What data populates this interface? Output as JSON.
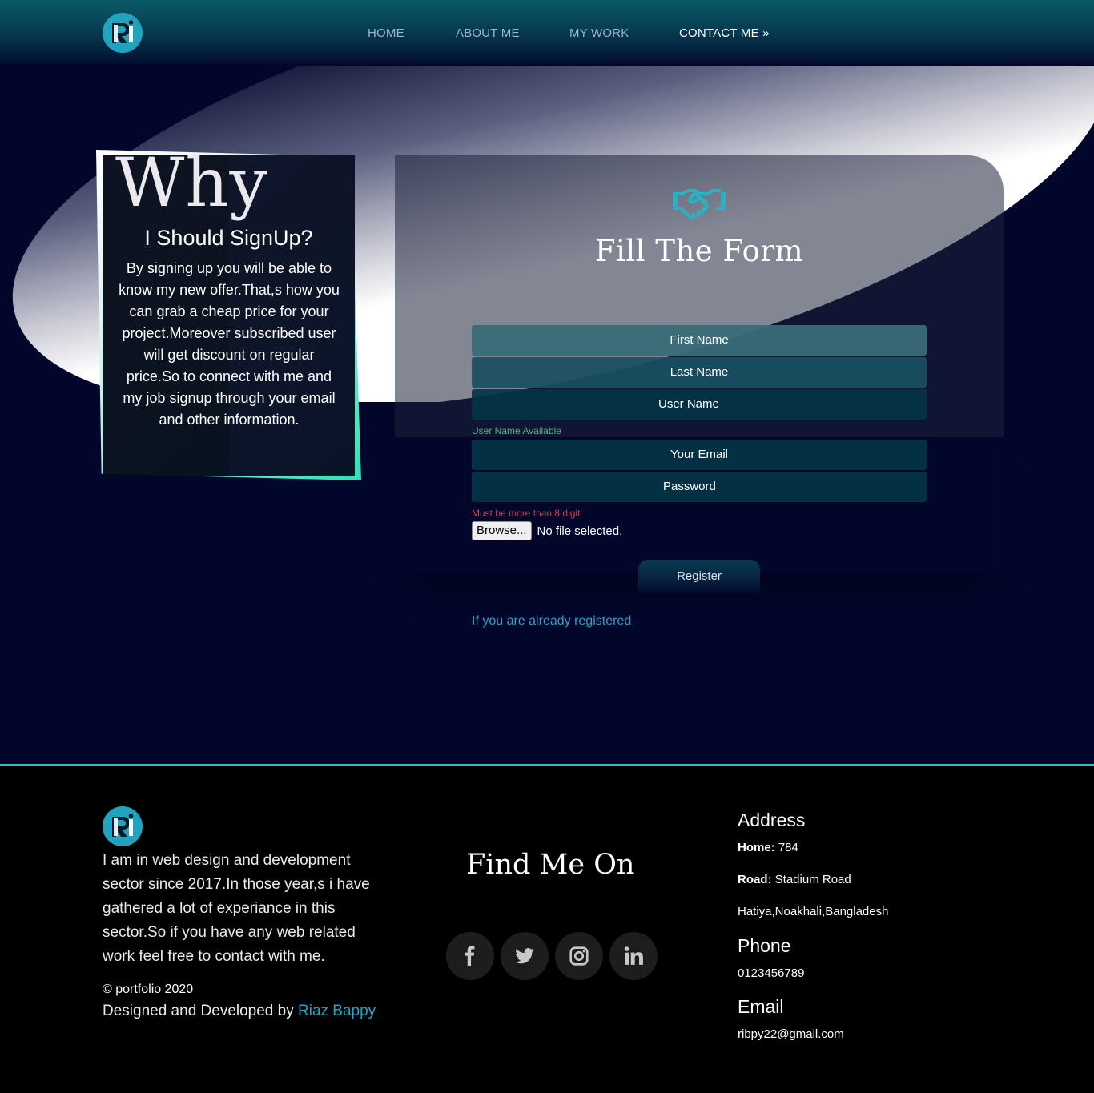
{
  "nav": {
    "logo_alt": "logo",
    "links": [
      {
        "label": "HOME",
        "active": false
      },
      {
        "label": "ABOUT ME",
        "active": false
      },
      {
        "label": "MY WORK",
        "active": false
      },
      {
        "label": "CONTACT ME »",
        "active": true
      }
    ]
  },
  "why": {
    "title": "Why",
    "subtitle": "I Should SignUp?",
    "text": "By signing up you will be able to know my new offer.That,s how you can grab a cheap price for your project.Moreover subscribed user will get discount on regular price.So to connect with me and my job signup through your email and other information."
  },
  "form": {
    "icon": "handshake-icon",
    "title": "Fill The Form",
    "first_name": "First Name",
    "last_name": "Last Name",
    "user_name": "User Name",
    "user_name_note": "User Name Available",
    "email": "Your Email",
    "password": "Password",
    "password_note": "Must be more than 8 digit",
    "browse_label": "Browse...",
    "file_status": "No file selected.",
    "register_label": "Register",
    "login_link": "If you are already registered"
  },
  "footer": {
    "about": "I am in web design and development sector since 2017.In those year,s i have gathered a lot of experiance in this sector.So if you have any web related work feel free to contact with me.",
    "copyright": "© portfolio 2020",
    "credit_prefix": "Designed and Developed by ",
    "credit_name": "Riaz Bappy",
    "find_me": "Find Me On",
    "socials": [
      "facebook-icon",
      "twitter-icon",
      "instagram-icon",
      "linkedin-icon"
    ],
    "address_heading": "Address",
    "home_label": "Home:",
    "home_value": " 784",
    "road_label": "Road:",
    "road_value": " Stadium Road",
    "city": "Hatiya,Noakhali,Bangladesh",
    "phone_heading": "Phone",
    "phone": "0123456789",
    "email_heading": "Email",
    "email": "ribpy22@gmail.com"
  },
  "colors": {
    "accent": "#1fa3be",
    "teal_border": "#29c3b4",
    "success": "#3fbf6a",
    "error": "#e0334f",
    "background": "#02062a"
  }
}
